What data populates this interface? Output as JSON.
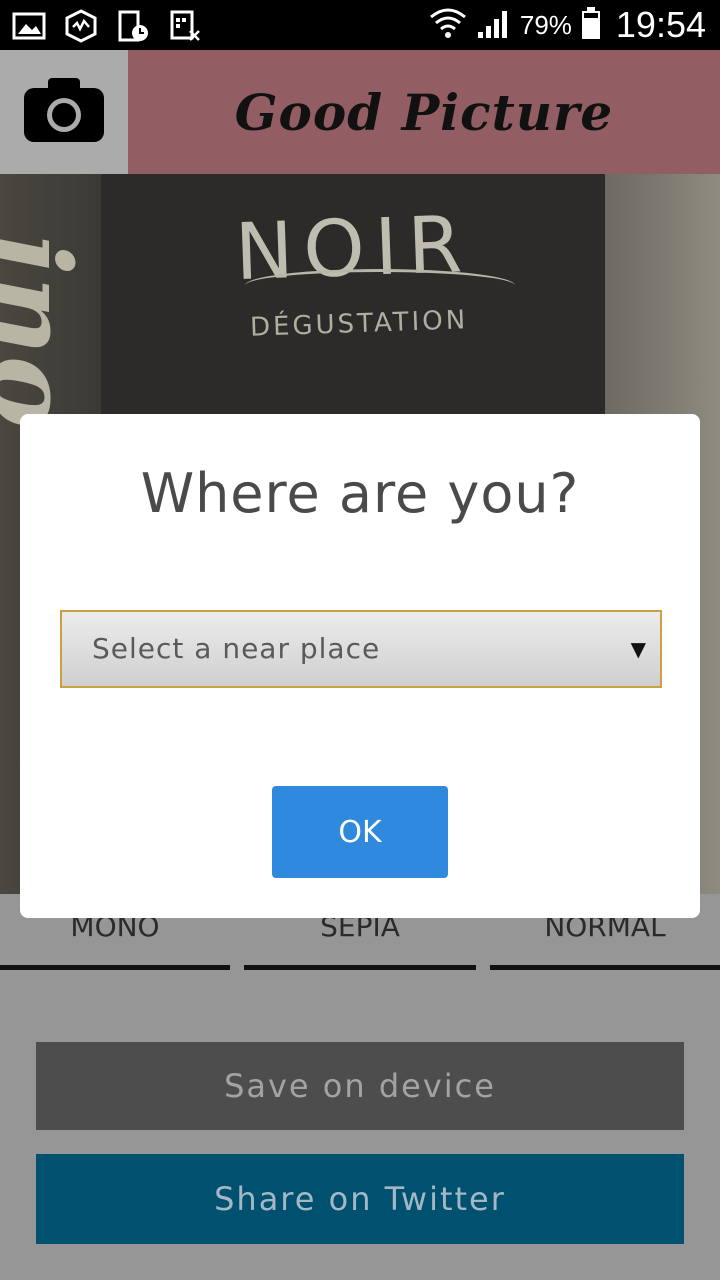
{
  "status_bar": {
    "battery_percent": "79%",
    "time": "19:54",
    "icons": [
      "gallery-icon",
      "vpn-icon",
      "phone-clock-icon",
      "sim-x-icon",
      "wifi-icon",
      "signal-icon",
      "battery-icon"
    ]
  },
  "header": {
    "title": "Good Picture",
    "camera_icon": "camera-icon",
    "colors": {
      "header_bg": "#935e63",
      "camera_bg": "#ababab"
    }
  },
  "photo": {
    "text_big": "NOIR",
    "text_small": "DÉGUSTATION",
    "text_side": "ino"
  },
  "filters": [
    {
      "label": "MONO"
    },
    {
      "label": "SEPIA"
    },
    {
      "label": "NORMAL"
    }
  ],
  "actions": {
    "save_label": "Save on device",
    "twitter_label": "Share on Twitter",
    "colors": {
      "save_bg": "#4d4d4d",
      "twitter_bg": "#00506f"
    }
  },
  "dialog": {
    "title": "Where are you?",
    "select_placeholder": "Select a near place",
    "ok_label": "OK",
    "colors": {
      "ok_bg": "#2f89dc",
      "select_border": "#caa041"
    }
  }
}
